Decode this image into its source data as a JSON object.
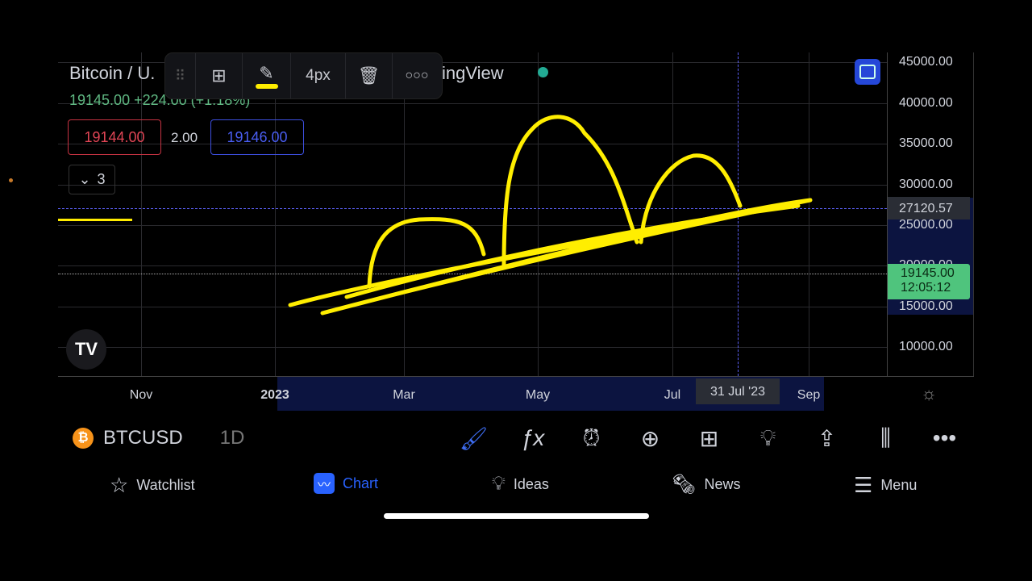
{
  "header": {
    "title_left": "Bitcoin / U.",
    "title_right": "ingView",
    "last_price": "19145.00",
    "change": "+224.00 (+1.18%)",
    "bid": "19144.00",
    "spread": "2.00",
    "ask": "19146.00",
    "collapse_count": "3",
    "status_color": "#22ab94"
  },
  "drawing_toolbar": {
    "stroke_width": "4px",
    "icons": [
      "drag-handle",
      "add-template",
      "pencil",
      "trash",
      "more"
    ],
    "active_color": "#ffff00"
  },
  "price_axis": {
    "labels": [
      "45000.00",
      "40000.00",
      "35000.00",
      "30000.00",
      "25000.00",
      "20000.00",
      "15000.00",
      "10000.00"
    ],
    "crosshair_price": "27120.57",
    "current_price": "19145.00",
    "countdown": "12:05:12",
    "current_color": "#4fc47d"
  },
  "time_axis": {
    "labels": [
      "Nov",
      "2023",
      "Mar",
      "May",
      "Jul",
      "Sep"
    ],
    "crosshair_date": "31 Jul '23"
  },
  "bottom_toolbar": {
    "symbol": "BTCUSD",
    "interval": "1D",
    "icons": [
      "brush",
      "fx",
      "alarm",
      "plus-circle",
      "grid",
      "lightbulb",
      "share",
      "candles",
      "more"
    ]
  },
  "tabs": [
    {
      "label": "Watchlist",
      "icon": "star"
    },
    {
      "label": "Chart",
      "icon": "chart",
      "active": true
    },
    {
      "label": "Ideas",
      "icon": "lightbulb"
    },
    {
      "label": "News",
      "icon": "news"
    },
    {
      "label": "Menu",
      "icon": "hamburger"
    }
  ],
  "accent": "#2962ff"
}
